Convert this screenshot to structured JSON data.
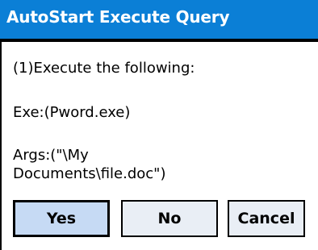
{
  "dialog": {
    "title": "AutoStart Execute Query",
    "lines": [
      "(1)Execute the following:",
      "Exe:(Pword.exe)",
      "Args:(\"\\My",
      "Documents\\file.doc\")"
    ]
  },
  "buttons": {
    "yes": "Yes",
    "no": "No",
    "cancel": "Cancel"
  },
  "colors": {
    "titlebar": "#0b7fd6",
    "default_button": "#c6daf4",
    "button": "#e9eef5"
  }
}
